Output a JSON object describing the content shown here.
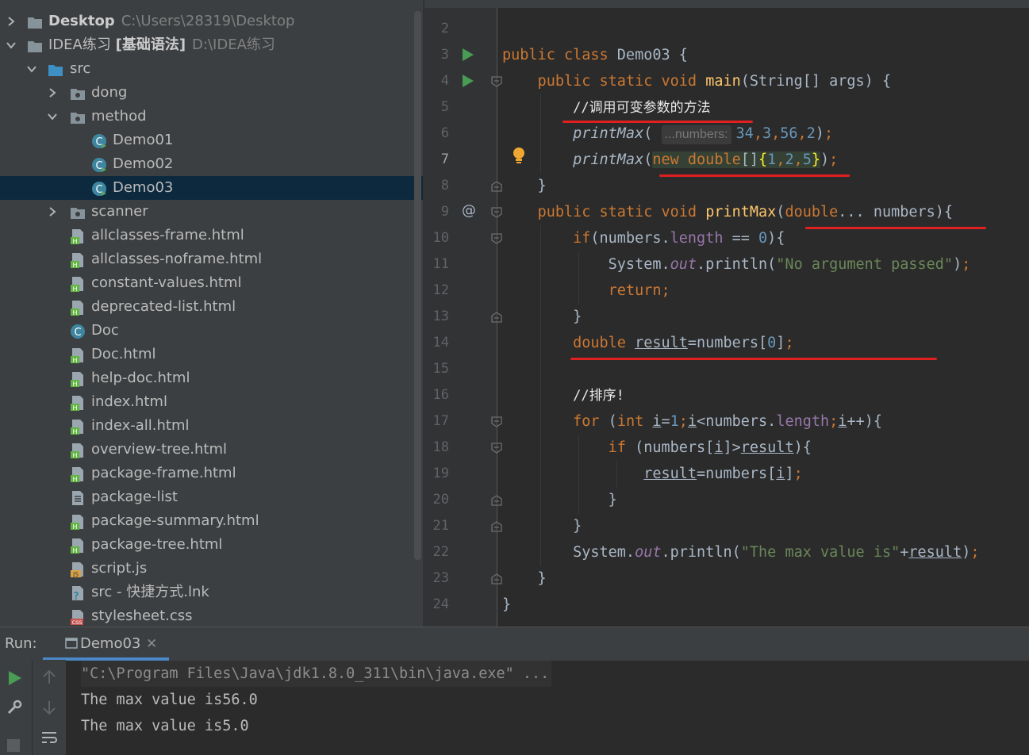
{
  "tree": {
    "items": [
      {
        "label": "Desktop",
        "path": "C:\\Users\\28319\\Desktop"
      },
      {
        "label": "IDEA练习",
        "suffix": "[基础语法]",
        "path": "D:\\IDEA练习"
      },
      {
        "label": "src"
      },
      {
        "label": "dong"
      },
      {
        "label": "method"
      },
      {
        "label": "Demo01"
      },
      {
        "label": "Demo02"
      },
      {
        "label": "Demo03"
      },
      {
        "label": "scanner"
      },
      {
        "label": "allclasses-frame.html"
      },
      {
        "label": "allclasses-noframe.html"
      },
      {
        "label": "constant-values.html"
      },
      {
        "label": "deprecated-list.html"
      },
      {
        "label": "Doc"
      },
      {
        "label": "Doc.html"
      },
      {
        "label": "help-doc.html"
      },
      {
        "label": "index.html"
      },
      {
        "label": "index-all.html"
      },
      {
        "label": "overview-tree.html"
      },
      {
        "label": "package-frame.html"
      },
      {
        "label": "package-list"
      },
      {
        "label": "package-summary.html"
      },
      {
        "label": "package-tree.html"
      },
      {
        "label": "script.js"
      },
      {
        "label": "src - 快捷方式.lnk"
      },
      {
        "label": "stylesheet.css"
      }
    ]
  },
  "editor": {
    "line_numbers": [
      "2",
      "3",
      "4",
      "5",
      "6",
      "7",
      "8",
      "9",
      "10",
      "11",
      "12",
      "13",
      "14",
      "15",
      "16",
      "17",
      "18",
      "19",
      "20",
      "21",
      "22",
      "23",
      "24"
    ],
    "param_hint": "...numbers:",
    "comment_call": "//调用可变参数的方法",
    "comment_sort": "//排序!",
    "string_no_arg": "\"No argument passed\"",
    "string_max": "\"The max value is\""
  },
  "run": {
    "title": "Run:",
    "tab_label": "Demo03",
    "output": [
      "\"C:\\Program Files\\Java\\jdk1.8.0_311\\bin\\java.exe\" ...",
      "The max value is56.0",
      "The max value is5.0"
    ]
  },
  "colors": {
    "background": "#2b2b2b",
    "keyword": "#cc7832",
    "method": "#ffc66d",
    "number": "#6897bb",
    "string": "#6a8759",
    "field": "#9876aa",
    "selection": "#0d293e",
    "annotation_red": "#e0201f"
  }
}
